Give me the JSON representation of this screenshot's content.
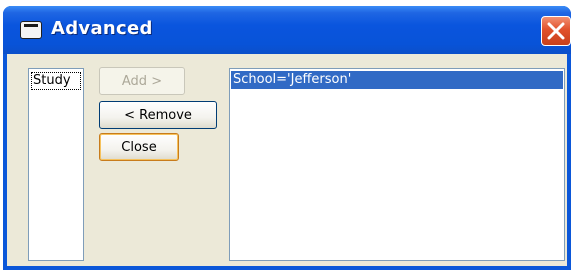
{
  "window": {
    "title": "Advanced",
    "close_icon": "close-icon"
  },
  "left_list": {
    "items": [
      "Study"
    ]
  },
  "buttons": {
    "add_label": "Add >",
    "remove_label": "< Remove",
    "close_label": "Close"
  },
  "right_list": {
    "items": [
      "School='Jefferson'"
    ]
  },
  "colors": {
    "titlebar": "#0853d8",
    "selection": "#316ac5",
    "client_bg": "#ece9d8",
    "close_button": "#e1512c"
  }
}
